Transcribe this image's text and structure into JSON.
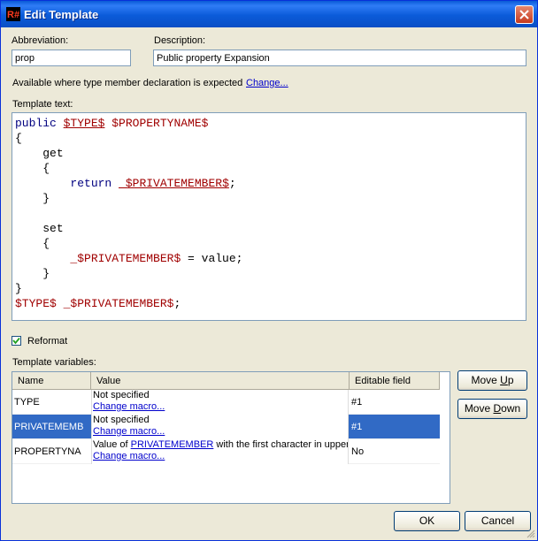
{
  "window": {
    "title": "Edit Template"
  },
  "fields": {
    "abbreviation_label": "Abbreviation:",
    "abbreviation_value": "prop",
    "description_label": "Description:",
    "description_value": "Public property Expansion"
  },
  "availability": {
    "text": "Available where type member declaration is expected",
    "change_link": "Change..."
  },
  "editor": {
    "label": "Template text:",
    "tokens": {
      "public": "public",
      "type": "$TYPE$",
      "propname": "$PROPERTYNAME$",
      "open_brace": "{",
      "close_brace": "}",
      "get": "get",
      "return": "return",
      "privmember": "_$PRIVATEMEMBER$",
      "semicolon": ";",
      "set": "set",
      "eq_value": " = value;"
    }
  },
  "reformat": {
    "label": "Reformat",
    "checked": true
  },
  "variables": {
    "label": "Template variables:",
    "columns": [
      "Name",
      "Value",
      "Editable field"
    ],
    "rows": [
      {
        "name": "TYPE",
        "value_line1": "Not specified",
        "value_link": "Change macro...",
        "editable": "#1",
        "selected": false
      },
      {
        "name": "PRIVATEMEMB",
        "value_line1": "Not specified",
        "value_link": "Change macro...",
        "editable": "#1",
        "selected": true
      },
      {
        "name": "PROPERTYNA",
        "value_prefix": "Value of ",
        "value_ref": "PRIVATEMEMBER",
        "value_suffix": " with the first character in upper case",
        "value_link": "Change macro...",
        "editable": "No",
        "selected": false
      }
    ]
  },
  "buttons": {
    "move_up_prefix": "Move ",
    "move_up_key": "U",
    "move_up_rest": "p",
    "move_down_prefix": "Move ",
    "move_down_key": "D",
    "move_down_rest": "own",
    "ok": "OK",
    "cancel": "Cancel"
  },
  "colors": {
    "title_bar": "#0a5ad6",
    "selection": "#316ac5",
    "keyword": "#000080",
    "variable": "#a00000"
  }
}
